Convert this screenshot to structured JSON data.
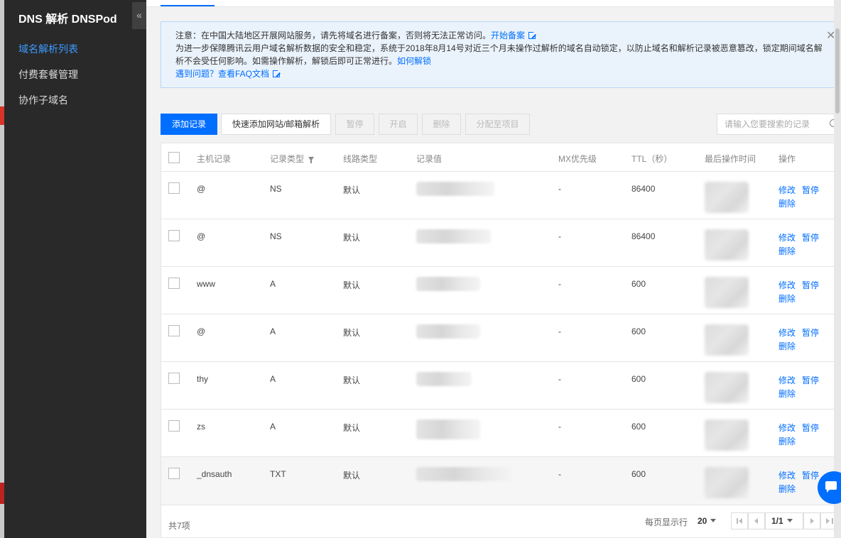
{
  "app": {
    "title": "DNS 解析 DNSPod",
    "collapse_icon": "«"
  },
  "sidebar": {
    "items": [
      {
        "label": "域名解析列表",
        "active": true
      },
      {
        "label": "付费套餐管理",
        "active": false
      },
      {
        "label": "协作子域名",
        "active": false
      }
    ]
  },
  "notice": {
    "line1_text": "注意：在中国大陆地区开展网站服务，请先将域名进行备案，否则将无法正常访问。",
    "line1_link": "开始备案",
    "line2_text": "为进一步保障腾讯云用户域名解析数据的安全和稳定，系统于2018年8月14号对近三个月未操作过解析的域名自动锁定，以防止域名和解析记录被恶意篡改，锁定期间域名解析不会受任何影响。如需操作解析，解锁后即可正常进行。",
    "line2_link": "如何解锁",
    "line3_link": "遇到问题？查看FAQ文档",
    "close_icon": "✕"
  },
  "toolbar": {
    "add_label": "添加记录",
    "quick_add_label": "快速添加网站/邮箱解析",
    "pause_label": "暂停",
    "enable_label": "开启",
    "delete_label": "删除",
    "assign_label": "分配至项目"
  },
  "search": {
    "placeholder": "请输入您要搜索的记录"
  },
  "table": {
    "headers": {
      "host": "主机记录",
      "type": "记录类型",
      "line": "线路类型",
      "value": "记录值",
      "mx": "MX优先级",
      "ttl": "TTL（秒）",
      "last_op": "最后操作时间",
      "action": "操作"
    },
    "rows": [
      {
        "host": "@",
        "type": "NS",
        "line": "默认",
        "mx": "-",
        "ttl": "86400"
      },
      {
        "host": "@",
        "type": "NS",
        "line": "默认",
        "mx": "-",
        "ttl": "86400"
      },
      {
        "host": "www",
        "type": "A",
        "line": "默认",
        "mx": "-",
        "ttl": "600"
      },
      {
        "host": "@",
        "type": "A",
        "line": "默认",
        "mx": "-",
        "ttl": "600"
      },
      {
        "host": "thy",
        "type": "A",
        "line": "默认",
        "mx": "-",
        "ttl": "600"
      },
      {
        "host": "zs",
        "type": "A",
        "line": "默认",
        "mx": "-",
        "ttl": "600"
      },
      {
        "host": "_dnsauth",
        "type": "TXT",
        "line": "默认",
        "mx": "-",
        "ttl": "600"
      }
    ],
    "actions": {
      "edit": "修改",
      "pause": "暂停",
      "delete": "删除"
    }
  },
  "pager": {
    "total": "共7项",
    "per_page_label": "每页显示行",
    "per_page": "20",
    "page": "1/1"
  },
  "colors": {
    "accent": "#006eff",
    "sidebar_bg": "#292929",
    "notice_bg": "#eaf3fc"
  }
}
